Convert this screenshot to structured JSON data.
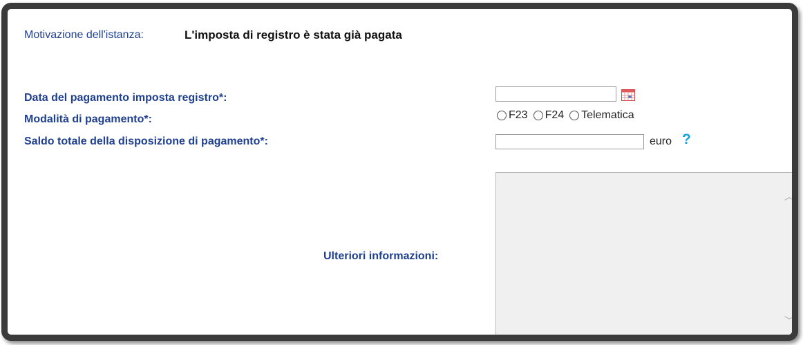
{
  "header": {
    "motivation_label": "Motivazione dell'istanza:",
    "motivation_value": "L'imposta di registro è stata già pagata"
  },
  "form": {
    "payment_date": {
      "label": "Data del pagamento imposta registro*:",
      "value": "",
      "icon": "calendar-icon"
    },
    "payment_mode": {
      "label": "Modalità di pagamento*:",
      "options": [
        "F23",
        "F24",
        "Telematica"
      ],
      "selected": null
    },
    "total_balance": {
      "label": "Saldo totale della disposizione di pagamento*:",
      "value": "",
      "unit": "euro",
      "help": "?"
    },
    "additional_info": {
      "label": "Ulteriori informazioni:",
      "value": ""
    }
  },
  "colors": {
    "label_blue": "#1f3f8f",
    "help_blue": "#1aa0e0",
    "frame": "#3b3b3b",
    "textarea_bg": "#f0f0f0"
  }
}
